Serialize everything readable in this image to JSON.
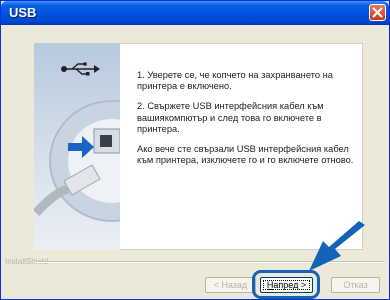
{
  "window": {
    "title": "USB"
  },
  "content": {
    "step1": "1. Уверете се, че копчето на захранването на принтера е включено.",
    "step2": "2. Свържете USB интерфейсния кабел към вашиякомпютър и след това го включете в принтера.",
    "note": "Ако вече сте свързали USB интерфейсния кабел към принтера, изключете го и го включете отново."
  },
  "footer": {
    "brand": "InstallShield"
  },
  "buttons": {
    "back": "< Назад",
    "next_accel": "Н",
    "next_rest": "апред >",
    "cancel": "Отказ"
  },
  "colors": {
    "title_bar": "#0054e3",
    "highlight": "#1563b8",
    "dialog_bg": "#ece9d8"
  }
}
